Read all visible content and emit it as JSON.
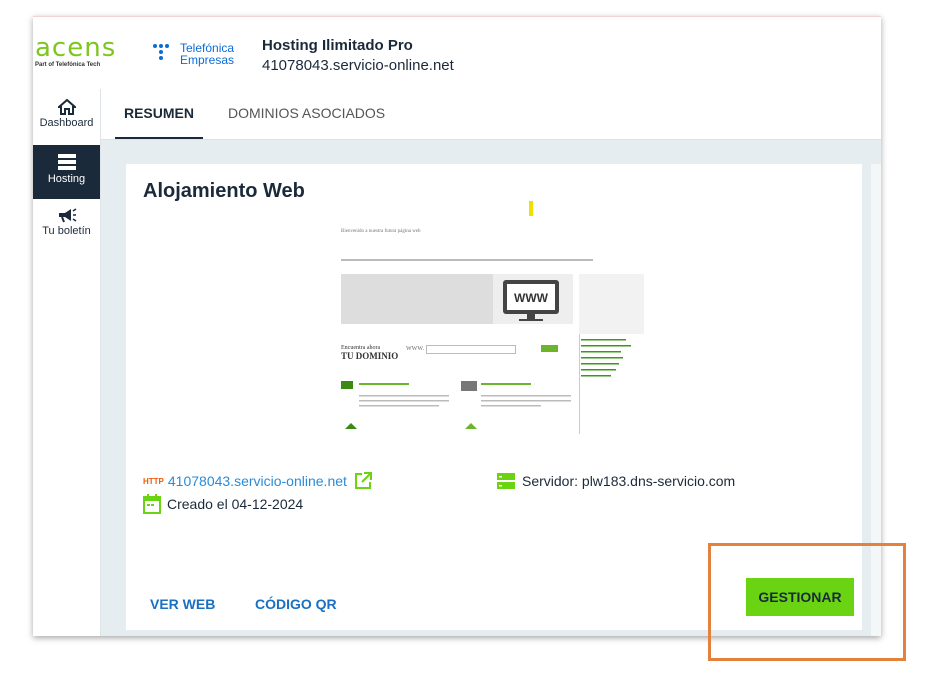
{
  "header": {
    "acens_logo_text": "acens",
    "acens_sub": "Part of Telefónica Tech",
    "telefonica_line1": "Telefónica",
    "telefonica_line2": "Empresas",
    "title": "Hosting Ilimitado Pro",
    "subtitle": "41078043.servicio-online.net"
  },
  "sidebar": {
    "items": [
      {
        "label": "Dashboard",
        "icon": "home-icon"
      },
      {
        "label": "Hosting",
        "icon": "server-icon",
        "active": true
      },
      {
        "label": "Tu boletín",
        "icon": "megaphone-icon"
      }
    ]
  },
  "tabs": [
    {
      "label": "RESUMEN",
      "active": true
    },
    {
      "label": "DOMINIOS ASOCIADOS",
      "active": false
    }
  ],
  "card": {
    "title": "Alojamiento Web",
    "preview": {
      "welcome": "Bienvenido a nuestra futura página web",
      "search_label_1": "Encuentra ahora",
      "search_label_2": "TU DOMINIO",
      "www": "WWW."
    },
    "http_tag": "HTTP",
    "domain_link": "41078043.servicio-online.net",
    "created": "Creado el 04-12-2024",
    "server": "Servidor: plw183.dns-servicio.com",
    "ver_web": "VER WEB",
    "codigo_qr": "CÓDIGO QR",
    "gestionar": "GESTIONAR"
  },
  "colors": {
    "brand_green": "#7cc61e",
    "button_green": "#6bd412",
    "navy": "#1b2a3a",
    "link_blue": "#2a8bd8",
    "highlight_orange": "#e2823c"
  }
}
